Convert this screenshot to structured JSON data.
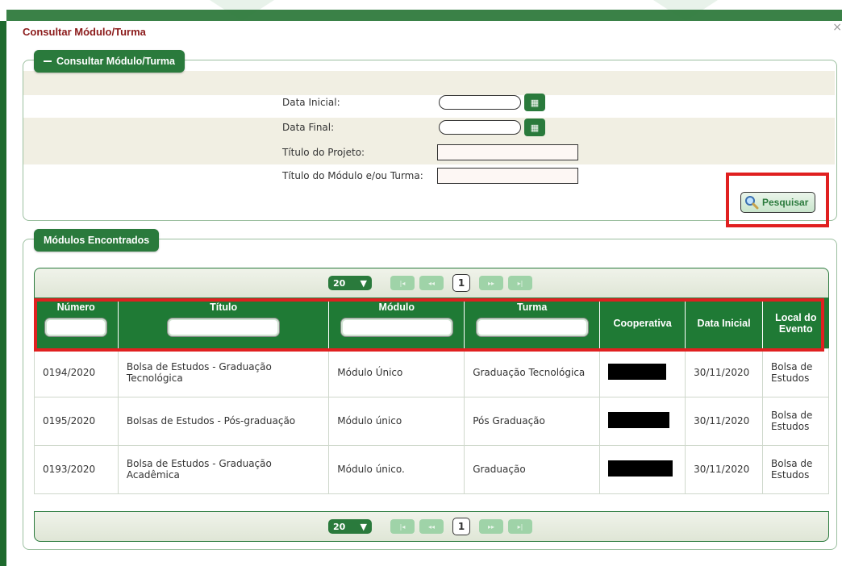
{
  "dialog": {
    "title": "Consultar Módulo/Turma",
    "close_icon_glyph": "×"
  },
  "search_panel": {
    "legend": "Consultar Módulo/Turma",
    "fields": {
      "data_inicial_label": "Data Inicial:",
      "data_final_label": "Data Final:",
      "titulo_projeto_label": "Título do Projeto:",
      "titulo_modulo_label": "Título do Módulo e/ou Turma:"
    },
    "search_button": "Pesquisar"
  },
  "results_panel": {
    "legend": "Módulos Encontrados",
    "pager": {
      "rows_per_page": "20",
      "current_page": "1"
    },
    "columns": [
      "Número",
      "Título",
      "Módulo",
      "Turma",
      "Cooperativa",
      "Data Inicial",
      "Local do Evento"
    ],
    "rows": [
      {
        "numero": "0194/2020",
        "titulo": "Bolsa de Estudos - Graduação Tecnológica",
        "modulo": "Módulo Único",
        "turma": "Graduação Tecnológica",
        "data_inicial": "30/11/2020",
        "local": "Bolsa de Estudos"
      },
      {
        "numero": "0195/2020",
        "titulo": "Bolsas de Estudos - Pós-graduação",
        "modulo": "Módulo único",
        "turma": "Pós Graduação",
        "data_inicial": "30/11/2020",
        "local": "Bolsa de Estudos"
      },
      {
        "numero": "0193/2020",
        "titulo": "Bolsa de Estudos - Graduação Acadêmica",
        "modulo": "Módulo único.",
        "turma": "Graduação",
        "data_inicial": "30/11/2020",
        "local": "Bolsa de Estudos"
      }
    ]
  },
  "colors": {
    "accent_green": "#2a7a3c",
    "highlight_red": "#e02020",
    "title_red": "#8b1a1a"
  }
}
